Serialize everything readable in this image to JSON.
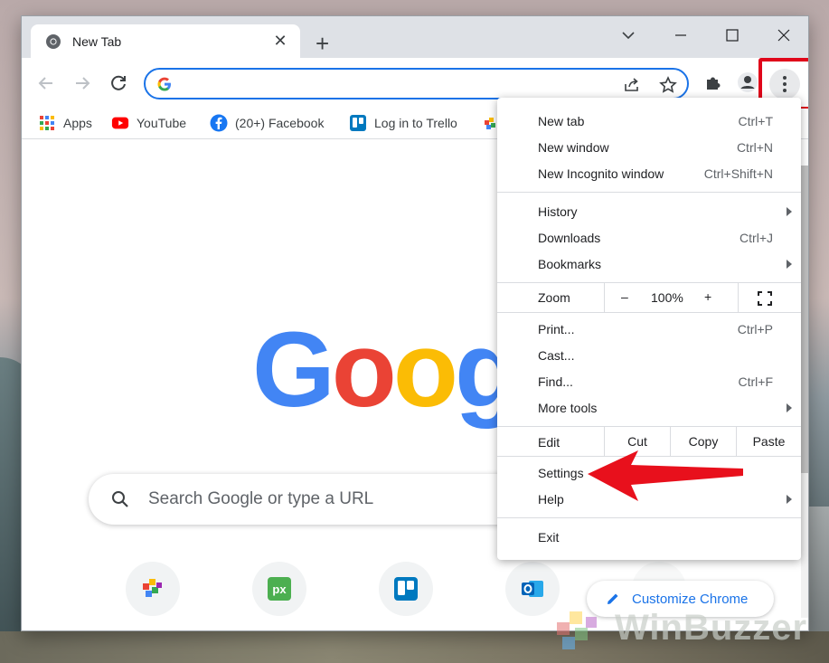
{
  "tab": {
    "title": "New Tab",
    "close_glyph": "✕",
    "new_tab_glyph": "+"
  },
  "bookmarks": [
    {
      "label": "Apps",
      "icon": "apps-grid-icon"
    },
    {
      "label": "YouTube",
      "icon": "youtube-icon"
    },
    {
      "label": "(20+) Facebook",
      "icon": "facebook-icon"
    },
    {
      "label": "Log in to Trello",
      "icon": "trello-icon"
    }
  ],
  "search": {
    "placeholder": "Search Google or type a URL"
  },
  "logo": {
    "letters": [
      "G",
      "o",
      "o",
      "g"
    ],
    "colors": [
      "#4285f4",
      "#ea4335",
      "#fbbc05",
      "#4285f4"
    ]
  },
  "customize": {
    "label": "Customize Chrome"
  },
  "menu": {
    "group1": [
      {
        "label": "New tab",
        "shortcut": "Ctrl+T"
      },
      {
        "label": "New window",
        "shortcut": "Ctrl+N"
      },
      {
        "label": "New Incognito window",
        "shortcut": "Ctrl+Shift+N"
      }
    ],
    "group2": [
      {
        "label": "History",
        "shortcut": "",
        "submenu": true
      },
      {
        "label": "Downloads",
        "shortcut": "Ctrl+J",
        "submenu": false
      },
      {
        "label": "Bookmarks",
        "shortcut": "",
        "submenu": true
      }
    ],
    "zoom": {
      "label": "Zoom",
      "minus": "–",
      "value": "100%",
      "plus": "+"
    },
    "group3": [
      {
        "label": "Print...",
        "shortcut": "Ctrl+P",
        "submenu": false
      },
      {
        "label": "Cast...",
        "shortcut": "",
        "submenu": false
      },
      {
        "label": "Find...",
        "shortcut": "Ctrl+F",
        "submenu": false
      },
      {
        "label": "More tools",
        "shortcut": "",
        "submenu": true
      }
    ],
    "edit": {
      "label": "Edit",
      "cut": "Cut",
      "copy": "Copy",
      "paste": "Paste"
    },
    "group4": [
      {
        "label": "Settings",
        "submenu": false
      },
      {
        "label": "Help",
        "submenu": true
      }
    ],
    "exit": {
      "label": "Exit"
    }
  },
  "watermark": {
    "text": "WinBuzzer"
  },
  "colors": {
    "accent": "#1a73e8",
    "highlight": "#e0061a",
    "arrow": "#e8101c"
  }
}
